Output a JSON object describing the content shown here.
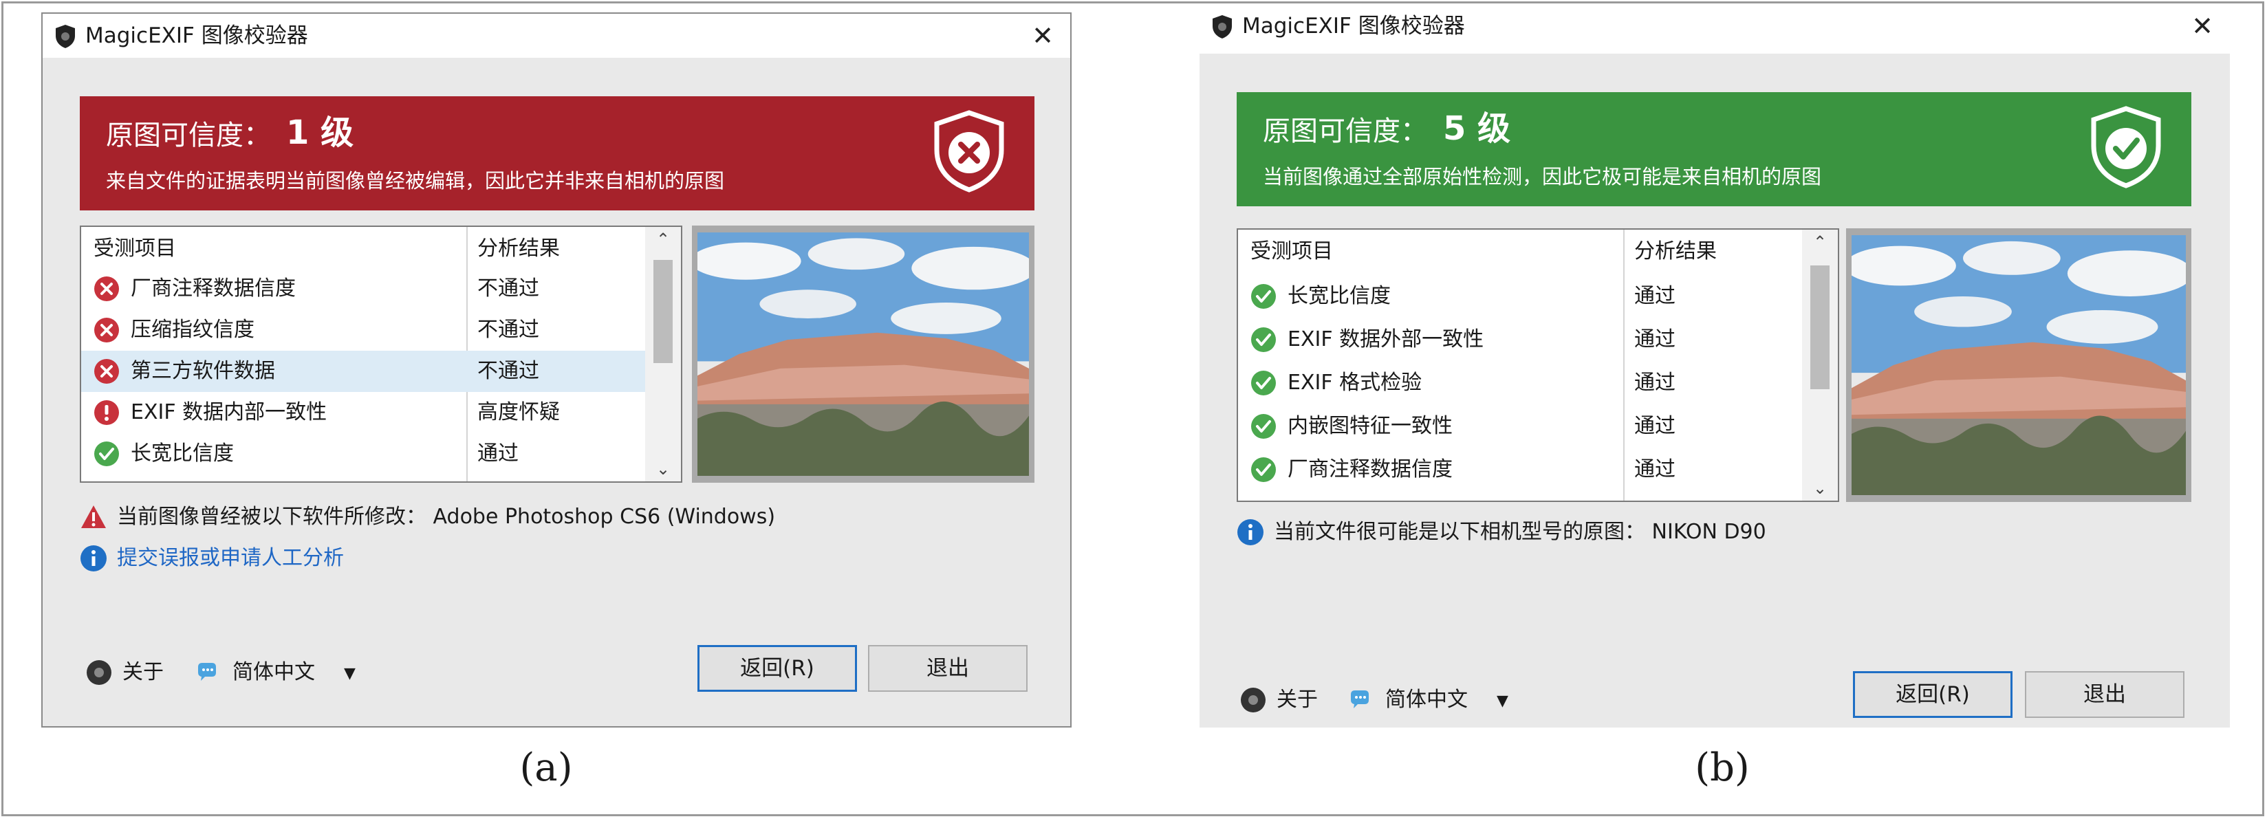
{
  "panels": [
    {
      "window_title": "MagicEXIF 图像校验器",
      "banner": {
        "label": "原图可信度：",
        "level": "1 级",
        "description": "来自文件的证据表明当前图像曾经被编辑，因此它并非来自相机的原图",
        "color": "#a6222b",
        "shield_icon": "shield-x-icon"
      },
      "table": {
        "headers": [
          "受测项目",
          "分析结果"
        ],
        "rows": [
          {
            "item": "厂商注释数据信度",
            "result": "不通过",
            "status": "fail"
          },
          {
            "item": "压缩指纹信度",
            "result": "不通过",
            "status": "fail"
          },
          {
            "item": "第三方软件数据",
            "result": "不通过",
            "status": "fail"
          },
          {
            "item": "EXIF 数据内部一致性",
            "result": "高度怀疑",
            "status": "warn"
          },
          {
            "item": "长宽比信度",
            "result": "通过",
            "status": "pass"
          }
        ]
      },
      "notices": [
        {
          "text": "当前图像曾经被以下软件所修改：  Adobe Photoshop CS6 (Windows)",
          "icon": "warning-icon"
        },
        {
          "text": "提交误报或申请人工分析",
          "icon": "info-icon",
          "link": true
        }
      ],
      "footer": {
        "about": "关于",
        "language": "简体中文"
      },
      "buttons": {
        "back": "返回(R)",
        "exit": "退出"
      },
      "caption": "(a)"
    },
    {
      "window_title": "MagicEXIF 图像校验器",
      "banner": {
        "label": "原图可信度：",
        "level": "5 级",
        "description": "当前图像通过全部原始性检测，因此它极可能是来自相机的原图",
        "color": "#3a9440",
        "shield_icon": "shield-check-icon"
      },
      "table": {
        "headers": [
          "受测项目",
          "分析结果"
        ],
        "rows": [
          {
            "item": "长宽比信度",
            "result": "通过",
            "status": "pass"
          },
          {
            "item": "EXIF 数据外部一致性",
            "result": "通过",
            "status": "pass"
          },
          {
            "item": "EXIF 格式检验",
            "result": "通过",
            "status": "pass"
          },
          {
            "item": "内嵌图特征一致性",
            "result": "通过",
            "status": "pass"
          },
          {
            "item": "厂商注释数据信度",
            "result": "通过",
            "status": "pass"
          }
        ]
      },
      "notices": [
        {
          "text": "当前文件很可能是以下相机型号的原图：  NIKON D90",
          "icon": "info-icon"
        }
      ],
      "footer": {
        "about": "关于",
        "language": "简体中文"
      },
      "buttons": {
        "back": "返回(R)",
        "exit": "退出"
      },
      "caption": "(b)"
    }
  ]
}
